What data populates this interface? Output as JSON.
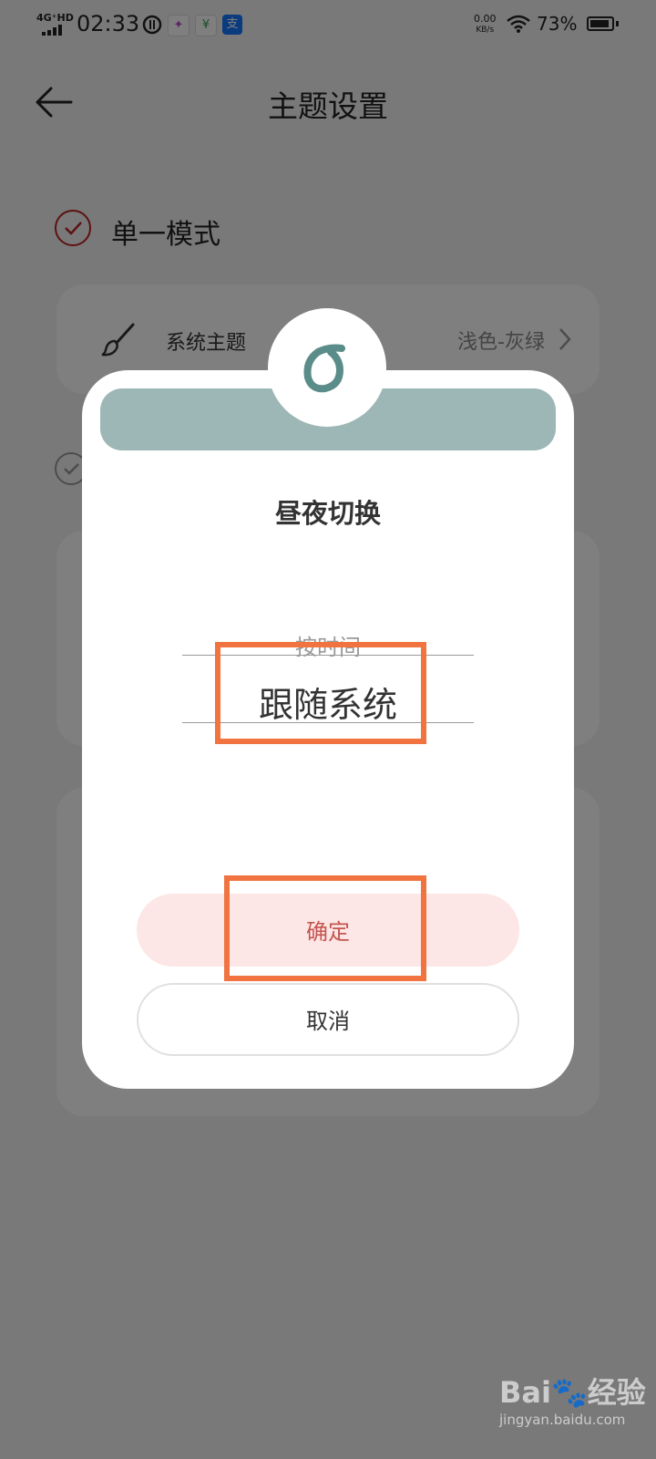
{
  "status_bar": {
    "network": "4G⁺HD",
    "time": "02:33",
    "speed_value": "0.00",
    "speed_unit": "KB/s",
    "battery": "73%"
  },
  "header": {
    "title": "主题设置"
  },
  "mode": {
    "label": "单一模式"
  },
  "theme_card": {
    "label": "系统主题",
    "value": "浅色-灰绿"
  },
  "dialog": {
    "title": "昼夜切换",
    "picker_option_above": "按时间",
    "picker_selected": "跟随系统",
    "ok_label": "确定",
    "cancel_label": "取消"
  },
  "watermark": {
    "logo": "Bai🐾经验",
    "url": "jingyan.baidu.com"
  },
  "colors": {
    "accent_red": "#c4564f",
    "band_green": "#9cb7b5",
    "logo_green": "#5a8c89",
    "highlight_orange": "#f07340"
  }
}
